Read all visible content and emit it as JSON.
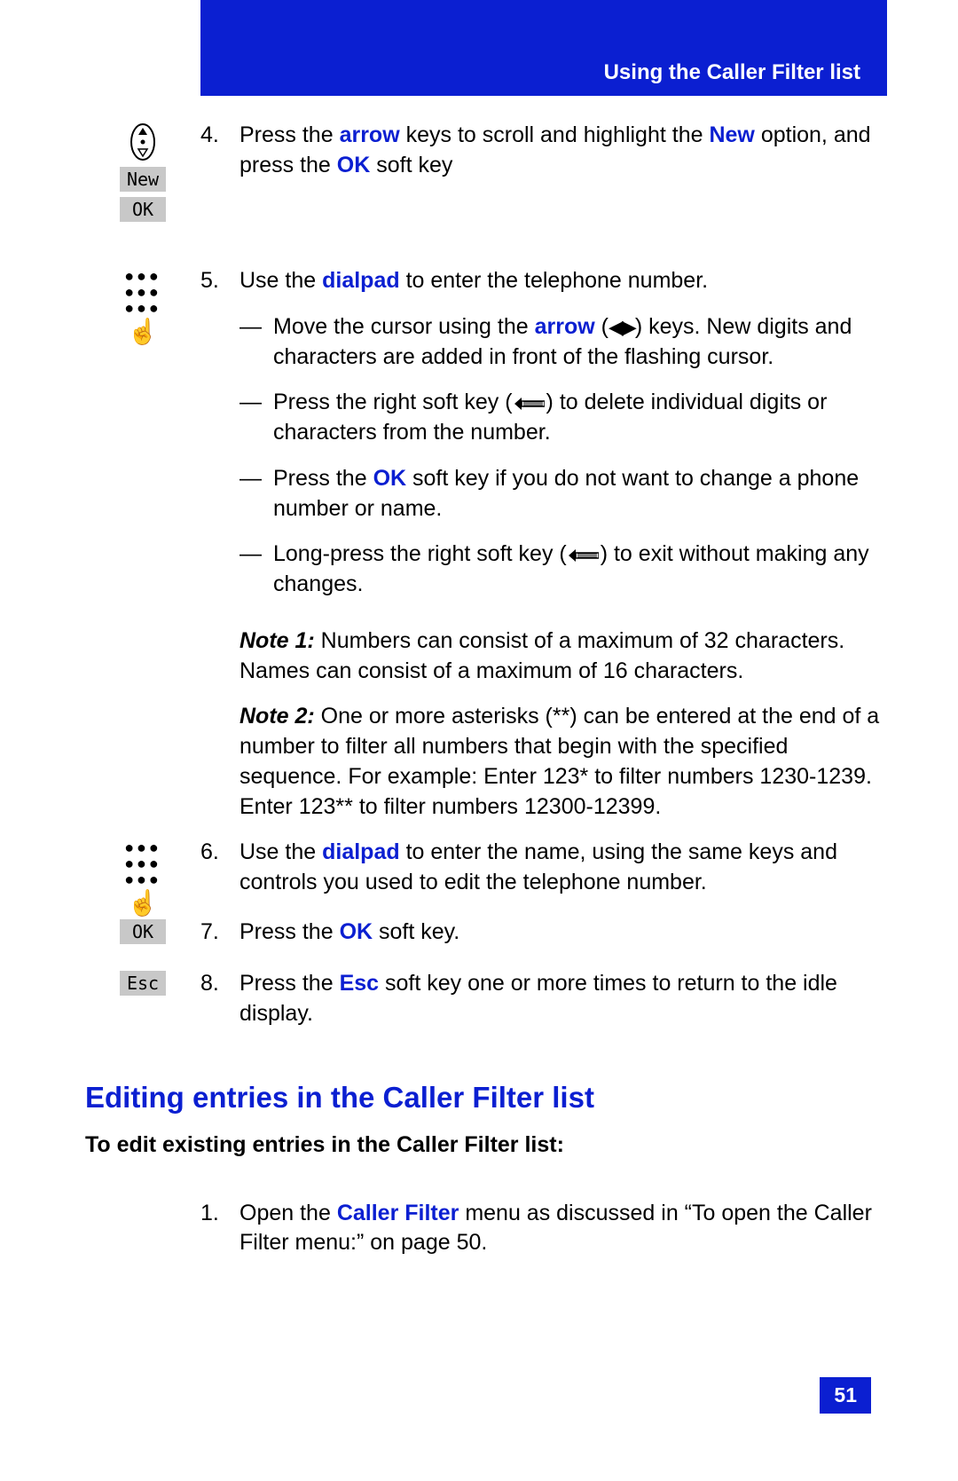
{
  "running_title": "Using the Caller Filter list",
  "page_number": "51",
  "icons": {
    "new": "New",
    "ok": "OK",
    "esc": "Esc"
  },
  "steps": {
    "s4": {
      "num": "4.",
      "t0": "Press the ",
      "k0": "arrow",
      "t1": " keys to scroll and highlight the ",
      "k1": "New",
      "t2": " option, and press the ",
      "k2": "OK",
      "t3": " soft key"
    },
    "s5": {
      "num": "5.",
      "t0": "Use the ",
      "k0": "dialpad",
      "t1": " to enter the telephone number.",
      "b1a": "Move the cursor using the ",
      "b1k": "arrow",
      "b1b": " (",
      "b1c": ") keys. New digits and characters are added in front of the flashing cursor.",
      "b2a": "Press the right soft key (",
      "b2b": ") to delete individual digits or characters from the number.",
      "b3a": "Press the ",
      "b3k": "OK",
      "b3b": " soft key if you do not want to change a phone number or name.",
      "b4a": "Long-press the right soft key (",
      "b4b": ") to exit without making any changes.",
      "n1l": "Note 1:",
      "n1": " Numbers can consist of a maximum of 32 characters. Names can consist of a maximum of 16 characters.",
      "n2l": "Note 2:",
      "n2": " One or more asterisks (**) can be entered at the end of a number to filter all numbers that begin with the specified sequence. For example: Enter 123* to filter numbers 1230-1239. Enter 123** to filter numbers 12300-12399."
    },
    "s6": {
      "num": "6.",
      "t0": "Use the ",
      "k0": "dialpad",
      "t1": " to enter the name, using the same keys and controls you used to edit the telephone number."
    },
    "s7": {
      "num": "7.",
      "t0": "Press the ",
      "k0": "OK",
      "t1": " soft key."
    },
    "s8": {
      "num": "8.",
      "t0": "Press the ",
      "k0": "Esc",
      "t1": " soft key one or more times to return to the idle display."
    }
  },
  "heading": "Editing entries in the Caller Filter list",
  "subheading": "To edit existing entries in the Caller Filter list:",
  "step_new": {
    "num": "1.",
    "t0": "Open the ",
    "k0": "Caller Filter",
    "t1": " menu as discussed in “To open the Caller Filter menu:” on page 50."
  }
}
